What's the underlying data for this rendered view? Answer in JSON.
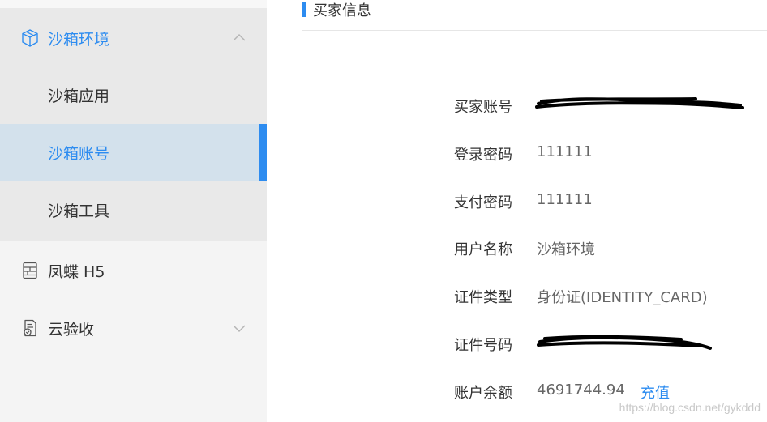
{
  "sidebar": {
    "groups": [
      {
        "label": "沙箱环境",
        "icon": "cube-icon",
        "expanded": true,
        "items": [
          {
            "label": "沙箱应用"
          },
          {
            "label": "沙箱账号"
          },
          {
            "label": "沙箱工具"
          }
        ]
      },
      {
        "label": "凤蝶 H5",
        "icon": "layout-icon"
      },
      {
        "label": "云验收",
        "icon": "document-check-icon"
      }
    ]
  },
  "section": {
    "title": "买家信息"
  },
  "buyer": {
    "account_label": "买家账号",
    "login_pwd_label": "登录密码",
    "login_pwd": "111111",
    "pay_pwd_label": "支付密码",
    "pay_pwd": "111111",
    "username_label": "用户名称",
    "username": "沙箱环境",
    "id_type_label": "证件类型",
    "id_type": "身份证(IDENTITY_CARD)",
    "id_no_label": "证件号码",
    "balance_label": "账户余额",
    "balance": "4691744.94",
    "recharge_label": "充值"
  },
  "watermark": "https://blog.csdn.net/gykddd",
  "colors": {
    "accent": "#2d8cf0",
    "active_bg": "#d3e1ec",
    "sidebar_bg": "#f4f4f4"
  }
}
